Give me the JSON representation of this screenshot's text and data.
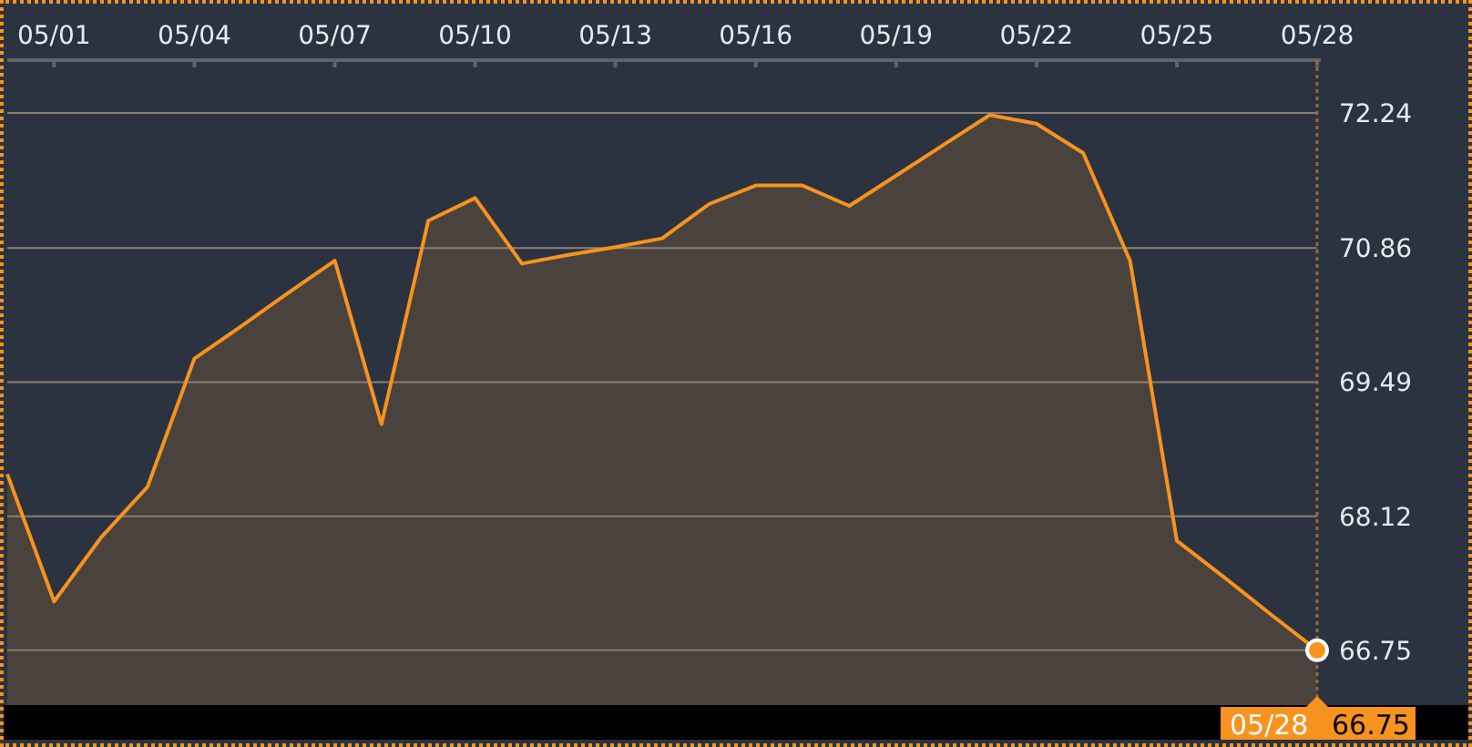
{
  "chart": {
    "chart_data": {
      "type": "area",
      "categories": [
        null,
        "05/01",
        null,
        null,
        "05/04",
        null,
        null,
        "05/07",
        null,
        null,
        "05/10",
        null,
        null,
        "05/13",
        null,
        null,
        "05/16",
        null,
        null,
        "05/19",
        null,
        null,
        "05/22",
        null,
        null,
        "05/25",
        null,
        null,
        "05/28"
      ],
      "series": [
        {
          "color": "#f7931e",
          "values": [
            68.55,
            67.25,
            67.9,
            68.42,
            69.73,
            70.06,
            70.4,
            70.73,
            69.06,
            71.14,
            71.37,
            70.7,
            70.79,
            70.87,
            70.96,
            71.31,
            71.5,
            71.5,
            71.29,
            71.6,
            71.91,
            72.22,
            72.13,
            71.83,
            70.73,
            67.87,
            67.5,
            67.12,
            66.75
          ]
        }
      ],
      "ylim": [
        66.19,
        72.78
      ],
      "grid": true,
      "yticks": [
        {
          "value": 66.75,
          "label": "66.75"
        },
        {
          "value": 68.12,
          "label": "68.12"
        },
        {
          "value": 69.49,
          "label": "69.49"
        },
        {
          "value": 70.86,
          "label": "70.86"
        },
        {
          "value": 72.24,
          "label": "72.24"
        }
      ]
    },
    "cursor": {
      "date_label": "05/28",
      "value_label": "66.75"
    }
  }
}
